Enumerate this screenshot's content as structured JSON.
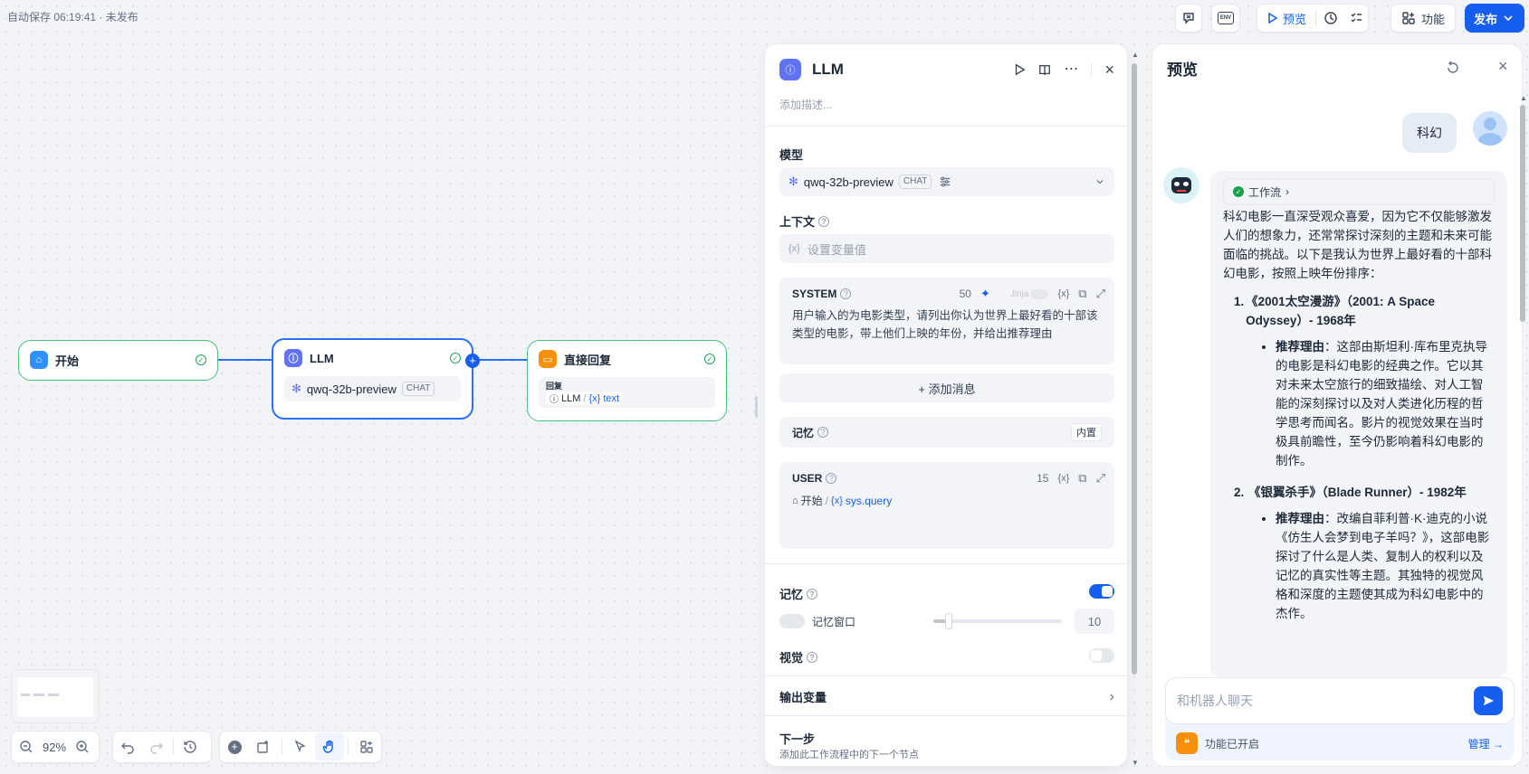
{
  "topbar": {
    "autosave": "自动保存 06:19:41 · 未发布",
    "preview_label": "预览",
    "features_label": "功能",
    "publish_label": "发布",
    "env_label": "ENV"
  },
  "nodes": {
    "start": {
      "title": "开始"
    },
    "llm": {
      "title": "LLM",
      "model": "qwq-32b-preview",
      "mode": "CHAT"
    },
    "answer": {
      "title": "直接回复",
      "field_label": "回复",
      "ref_node": "LLM",
      "ref_var": "text"
    }
  },
  "panel": {
    "title": "LLM",
    "desc_placeholder": "添加描述...",
    "model_label": "模型",
    "model_name": "qwq-32b-preview",
    "model_mode": "CHAT",
    "context_label": "上下文",
    "context_placeholder": "设置变量值",
    "system_label": "SYSTEM",
    "system_count": "50",
    "jinja_label": "Jinja",
    "system_text": "用户输入的为电影类型，请列出你认为世界上最好看的十部该类型的电影，带上他们上映的年份，并给出推荐理由",
    "add_message": "+ 添加消息",
    "memory_row_label": "记忆",
    "memory_builtin": "内置",
    "user_label": "USER",
    "user_count": "15",
    "user_ref_node": "开始",
    "user_ref_var": "sys.query",
    "memory_label": "记忆",
    "memory_window_label": "记忆窗口",
    "memory_window_value": "10",
    "memory_window_level": 0.12,
    "vision_label": "视觉",
    "output_label": "输出变量",
    "next_label": "下一步",
    "next_desc": "添加此工作流程中的下一个节点",
    "var_glyph": "{x}"
  },
  "preview": {
    "title": "预览",
    "user_msg": "科幻",
    "workflow_label": "工作流",
    "intro": "科幻电影一直深受观众喜爱，因为它不仅能够激发人们的想象力，还常常探讨深刻的主题和未来可能面临的挑战。以下是我认为世界上最好看的十部科幻电影，按照上映年份排序：",
    "items": [
      {
        "num": "1.",
        "title": "《2001太空漫游》（2001: A Space Odyssey）- 1968年",
        "reason_label": "推荐理由",
        "reason": "：这部由斯坦利·库布里克执导的电影是科幻电影的经典之作。它以其对未来太空旅行的细致描绘、对人工智能的深刻探讨以及对人类进化历程的哲学思考而闻名。影片的视觉效果在当时极具前瞻性，至今仍影响着科幻电影的制作。"
      },
      {
        "num": "2.",
        "title": "《银翼杀手》（Blade Runner）- 1982年",
        "reason_label": "推荐理由",
        "reason": "：改编自菲利普·K·迪克的小说《仿生人会梦到电子羊吗？》，这部电影探讨了什么是人类、复制人的权利以及记忆的真实性等主题。其独特的视觉风格和深度的主题使其成为科幻电影中的杰作。"
      }
    ],
    "input_placeholder": "和机器人聊天",
    "features_enabled": "功能已开启",
    "manage_label": "管理"
  },
  "bottom": {
    "zoom": "92%"
  },
  "colors": {
    "primary": "#155eef",
    "node_ok": "#4ac27b",
    "llm_icon": "#6172f3",
    "start_icon": "#2e90fa",
    "answer_icon": "#f79009"
  }
}
